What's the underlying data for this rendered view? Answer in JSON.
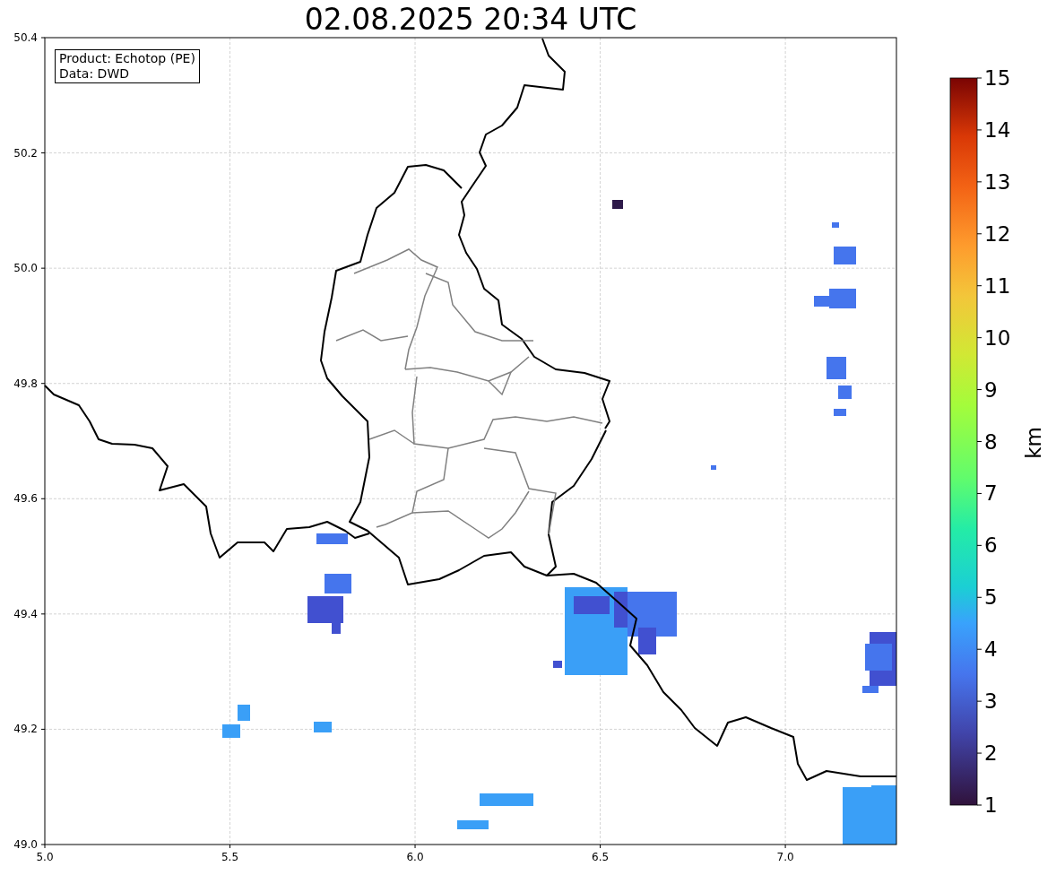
{
  "title": "02.08.2025 20:34 UTC",
  "info_box": {
    "lines": [
      "Product: Echotop (PE)",
      "Data: DWD"
    ]
  },
  "map": {
    "x_tick_labels": [
      "5.0",
      "5.5",
      "6.0",
      "6.5",
      "7.0"
    ],
    "y_tick_labels": [
      "50.4",
      "50.2",
      "50.0",
      "49.8",
      "49.6",
      "49.4",
      "49.2",
      "49.0"
    ]
  },
  "colorbar": {
    "label": "km",
    "tick_labels": [
      "15",
      "14",
      "13",
      "12",
      "11",
      "10",
      "9",
      "8",
      "7",
      "6",
      "5",
      "4",
      "3",
      "2",
      "1"
    ]
  }
}
